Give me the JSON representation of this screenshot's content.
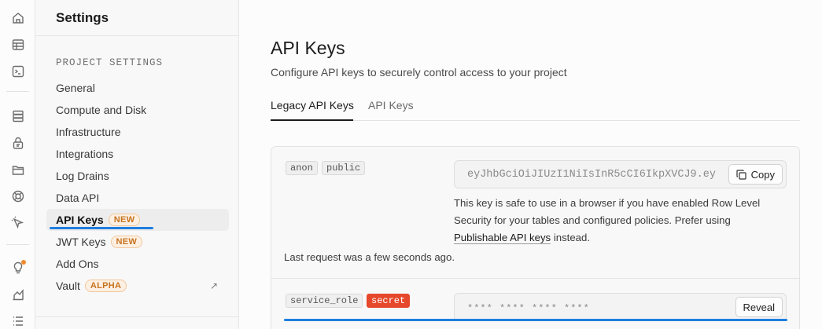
{
  "sidebar": {
    "title": "Settings",
    "section_label": "PROJECT SETTINGS",
    "items": [
      {
        "label": "General"
      },
      {
        "label": "Compute and Disk"
      },
      {
        "label": "Infrastructure"
      },
      {
        "label": "Integrations"
      },
      {
        "label": "Log Drains"
      },
      {
        "label": "Data API"
      },
      {
        "label": "API Keys",
        "badge": "NEW",
        "active": true
      },
      {
        "label": "JWT Keys",
        "badge": "NEW"
      },
      {
        "label": "Add Ons"
      },
      {
        "label": "Vault",
        "badge": "ALPHA"
      }
    ]
  },
  "rail": {
    "icons": [
      "home-icon",
      "table-editor-icon",
      "sql-editor-icon",
      "database-icon",
      "auth-icon",
      "storage-icon",
      "realtime-icon",
      "advisors-icon",
      "reports-icon",
      "logs-icon"
    ]
  },
  "main": {
    "title": "API Keys",
    "subtitle": "Configure API keys to securely control access to your project",
    "tabs": [
      {
        "label": "Legacy API Keys",
        "active": true
      },
      {
        "label": "API Keys",
        "active": false
      }
    ],
    "anon": {
      "tags": [
        "anon",
        "public"
      ],
      "key": "eyJhbGciOiJIUzI1NiIsInR5cCI6IkpXVCJ9.ey",
      "copy_label": "Copy",
      "note_part1": "This key is safe to use in a browser if you have enabled Row Level Security for your tables and configured policies. Prefer using ",
      "note_link": "Publishable API keys",
      "note_part2": " instead.",
      "last_request": "Last request was a few seconds ago."
    },
    "service": {
      "tags": [
        "service_role",
        "secret"
      ],
      "masked_key": "**** **** **** ****",
      "reveal_label": "Reveal"
    }
  },
  "colors": {
    "accent_blue": "#1f7fe0",
    "badge_orange": "#c7731f",
    "secret_red": "#e5482a"
  }
}
